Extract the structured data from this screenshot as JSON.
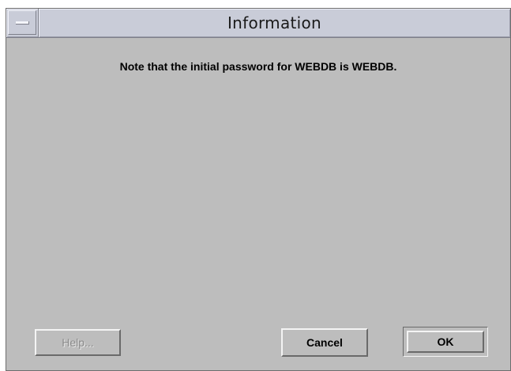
{
  "window": {
    "title": "Information",
    "menu_icon": "window-menu-icon"
  },
  "dialog": {
    "message": "Note that the initial password for WEBDB is WEBDB."
  },
  "buttons": {
    "help_label": "Help...",
    "cancel_label": "Cancel",
    "ok_label": "OK",
    "help_enabled": false
  },
  "colors": {
    "background": "#bdbdbd",
    "titlebar": "#c9ccd8"
  }
}
